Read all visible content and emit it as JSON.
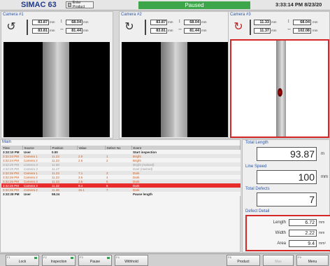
{
  "header": {
    "brand": "SIMAC 63",
    "product_button": "Enter Product",
    "status": "Paused",
    "clock": "3:33:14 PM 8/23/20"
  },
  "cameras": [
    {
      "title": "Camera #1",
      "rot_icon": "rotate-ccw-icon",
      "val1": "83.87",
      "val2": "83.81",
      "val3": "68.04",
      "val4": "81.44",
      "unit": "mm"
    },
    {
      "title": "Camera #2",
      "rot_icon": "rotate-cw-icon",
      "val1": "83.87",
      "val2": "83.81",
      "val3": "68.04",
      "val4": "81.44",
      "unit": "mm"
    },
    {
      "title": "Camera #3",
      "rot_icon": "rotate-red-icon",
      "val1": "11.33",
      "val2": "11.37",
      "val3": "68.04",
      "val4": "102.08",
      "unit": "mm"
    }
  ],
  "main": {
    "title": "Main",
    "columns": [
      "Time",
      "Source",
      "Position",
      "Value",
      "Defect No",
      "Event"
    ],
    "rows": [
      {
        "time": "3:32:10 PM",
        "source": "User",
        "position": "0.00",
        "value": "",
        "defect": "",
        "event": "Start inspection",
        "style": "bold"
      },
      {
        "time": "3:32:24 PM",
        "source": "Camera 1",
        "position": "11.23",
        "value": "2.0",
        "defect": "1",
        "event": "Bright",
        "style": "orange"
      },
      {
        "time": "3:32:24 PM",
        "source": "Camera 2",
        "position": "11.23",
        "value": "2.5",
        "defect": "2",
        "event": "Bright",
        "style": "orange"
      },
      {
        "time": "3:32:25 PM",
        "source": "Camera 3",
        "position": "11.60",
        "value": "",
        "defect": "",
        "event": "Bright (noticed)",
        "style": "dim"
      },
      {
        "time": "3:32:25 PM",
        "source": "Camera 3",
        "position": "11.27",
        "value": "",
        "defect": "",
        "event": "Dark (noticed)",
        "style": "dim"
      },
      {
        "time": "3:32:26 PM",
        "source": "Camera 1",
        "position": "11.23",
        "value": "7.1",
        "defect": "3",
        "event": "Dark",
        "style": "orange"
      },
      {
        "time": "3:32:26 PM",
        "source": "Camera 2",
        "position": "11.23",
        "value": "3.6",
        "defect": "4",
        "event": "Dark",
        "style": "orange"
      },
      {
        "time": "3:32:26 PM",
        "source": "Camera 3",
        "position": "11.23",
        "value": "3.6",
        "defect": "5",
        "event": "Dark",
        "style": "orange"
      },
      {
        "time": "3:32:26 PM",
        "source": "Camera 3",
        "position": "11.32",
        "value": "9.4",
        "defect": "6",
        "event": "Dark",
        "style": "sel"
      },
      {
        "time": "3:32:26 PM",
        "source": "Camera 2",
        "position": "11.36",
        "value": "15.1",
        "defect": "7",
        "event": "Dark",
        "style": "orange"
      },
      {
        "time": "3:32:28 PM",
        "source": "User",
        "position": "58.24",
        "value": "",
        "defect": "",
        "event": "Pause length",
        "style": "bold"
      }
    ]
  },
  "stats": {
    "total_length_label": "Total Length",
    "total_length": "93.87",
    "total_length_unit": "m",
    "line_speed_label": "Line Speed",
    "line_speed": "100",
    "line_speed_unit": "mm",
    "total_defects_label": "Total Defects",
    "total_defects": "7",
    "defect_detail_label": "Defect Detail",
    "length_label": "Length",
    "length_value": "6.72",
    "length_unit": "mm",
    "width_label": "Width",
    "width_value": "2.22",
    "width_unit": "mm",
    "area_label": "Area",
    "area_value": "9.4",
    "area_unit": "mm²"
  },
  "toolbar": {
    "buttons": [
      {
        "key": "F1",
        "label": "Lock"
      },
      {
        "key": "F2",
        "label": "Inspection"
      },
      {
        "key": "F3",
        "label": "Pause"
      },
      {
        "key": "F4",
        "label": "Withhold"
      },
      {
        "key": "F8",
        "label": "Product"
      },
      {
        "key": "",
        "label": "Max"
      },
      {
        "key": "F9",
        "label": "Menu"
      }
    ]
  },
  "colors": {
    "status_green": "#3ea64a",
    "alert_red": "#d62828",
    "brand_blue": "#203a8c",
    "defect_orange": "#d15c1a"
  }
}
